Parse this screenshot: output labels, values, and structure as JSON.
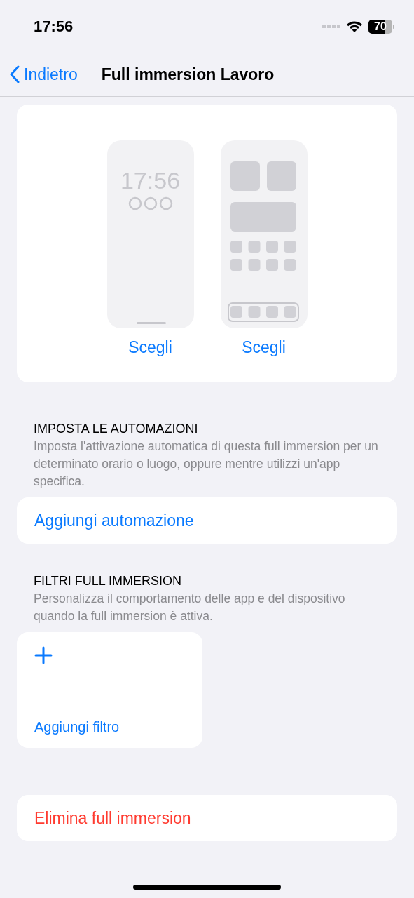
{
  "status_bar": {
    "time": "17:56",
    "battery": "70"
  },
  "nav": {
    "back": "Indietro",
    "title": "Full immersion Lavoro"
  },
  "previews": [
    {
      "kind": "lock",
      "clock": "17:56",
      "action": "Scegli"
    },
    {
      "kind": "home",
      "action": "Scegli"
    }
  ],
  "automations": {
    "header": "IMPOSTA LE AUTOMAZIONI",
    "description": "Imposta l'attivazione automatica di questa full immersion per un determinato orario o luogo, oppure mentre utilizzi un'app specifica.",
    "button": "Aggiungi automazione"
  },
  "filters": {
    "header": "FILTRI FULL IMMERSION",
    "description": "Personalizza il comportamento delle app e del dispositivo quando la full immersion è attiva.",
    "button": "Aggiungi filtro"
  },
  "delete_button": "Elimina full immersion"
}
